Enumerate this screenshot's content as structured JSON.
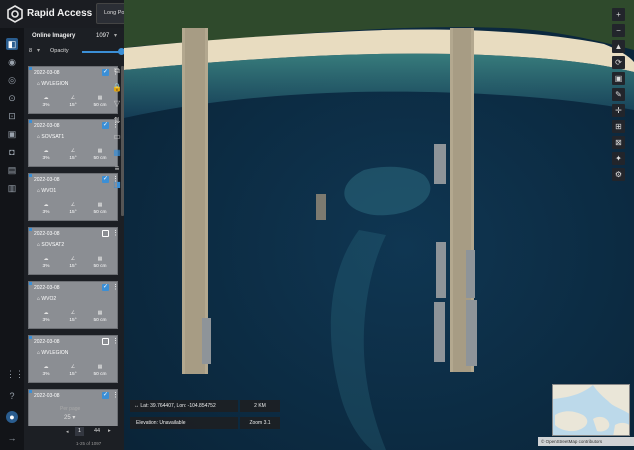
{
  "app": {
    "title": "Rapid Access"
  },
  "search": {
    "value": "Long Po San, Jiyang Distri..."
  },
  "panel": {
    "title": "Online Imagery",
    "count": "1097",
    "opacity_value": "8",
    "opacity_label": "Opacity",
    "opacity_level": 1.0
  },
  "cards": [
    {
      "date": "2022-03-08",
      "satellite": "WVLEGION",
      "cloud": "3%",
      "angle": "15°",
      "resolution": "50 cm",
      "checked": true
    },
    {
      "date": "2022-03-08",
      "satellite": "SOVSAT1",
      "cloud": "3%",
      "angle": "15°",
      "resolution": "50 cm",
      "checked": true
    },
    {
      "date": "2022-03-08",
      "satellite": "WVO1",
      "cloud": "3%",
      "angle": "15°",
      "resolution": "50 cm",
      "checked": true
    },
    {
      "date": "2022-03-08",
      "satellite": "SOVSAT2",
      "cloud": "3%",
      "angle": "15°",
      "resolution": "50 cm",
      "checked": false
    },
    {
      "date": "2022-03-08",
      "satellite": "WVO2",
      "cloud": "3%",
      "angle": "15°",
      "resolution": "50 cm",
      "checked": true
    },
    {
      "date": "2022-03-08",
      "satellite": "WVLEGION",
      "cloud": "3%",
      "angle": "15°",
      "resolution": "50 cm",
      "checked": false
    },
    {
      "date": "2022-03-08",
      "satellite": "",
      "cloud": "",
      "angle": "",
      "resolution": "",
      "checked": true
    }
  ],
  "pager": {
    "label": "Per page",
    "size": "25",
    "current": "1",
    "total": "44",
    "range": "1-25 of 1097"
  },
  "map": {
    "coords": "Lat: 39.764407, Lon: -104.854752",
    "scale": "2 KM",
    "elevation": "Elevation: Unavailable",
    "zoom": "Zoom 3.1",
    "attribution": "© OpenStreetMap contributors"
  },
  "icons": {
    "rail": [
      "layers-icon",
      "globe-icon",
      "globe-alt-icon",
      "target-icon",
      "crop-icon",
      "briefcase-icon",
      "camera-icon",
      "document-icon",
      "chart-icon"
    ],
    "rail_bottom": [
      "apps-icon",
      "help-icon",
      "user-icon",
      "logout-icon"
    ],
    "tools": [
      "layers-stack-icon",
      "lock-icon",
      "filter-icon",
      "sort-icon",
      "calendar-icon",
      "grid-icon",
      "list-icon",
      "split-view-icon"
    ],
    "map_tools": [
      "north-arrow-icon",
      "rotate-icon",
      "image-icon",
      "pencil-icon",
      "crosshair-icon",
      "grid-icon",
      "pen-box-icon",
      "sparkle-icon",
      "settings-icon"
    ]
  },
  "colors": {
    "accent": "#3b8fd6",
    "panel": "#1c1f24",
    "card": "#8b8e93"
  }
}
